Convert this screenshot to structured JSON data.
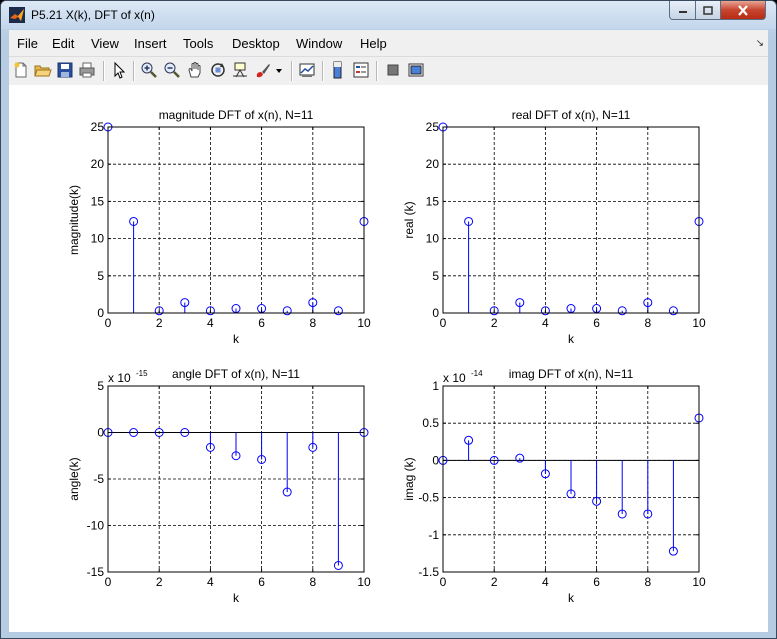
{
  "window": {
    "title": "P5.21 X(k), DFT of x(n)"
  },
  "menu": {
    "items": [
      "File",
      "Edit",
      "View",
      "Insert",
      "Tools",
      "Desktop",
      "Window",
      "Help"
    ]
  },
  "toolbar_icons": [
    "new-figure-icon",
    "open-file-icon",
    "save-icon",
    "print-icon",
    "arrow-select-icon",
    "zoom-in-icon",
    "zoom-out-icon",
    "pan-hand-icon",
    "rotate-3d-icon",
    "data-cursor-icon",
    "brush-icon",
    "dropdown-arrow-icon",
    "link-plot-icon",
    "colorbar-icon",
    "legend-icon",
    "hide-plot-tools-icon",
    "show-plot-tools-icon"
  ],
  "colors": {
    "stem": "#0000ff",
    "axes": "#000000",
    "grid": "#000000"
  },
  "chart_data": [
    {
      "type": "stem",
      "title": "magnitude DFT of x(n), N=11",
      "xlabel": "k",
      "ylabel": "magnitude(k)",
      "xlim": [
        0,
        10
      ],
      "ylim": [
        0,
        25
      ],
      "grid": true,
      "exponent": "",
      "xticks": [
        "0",
        "2",
        "4",
        "6",
        "8",
        "10"
      ],
      "xtick_values": [
        0,
        2,
        4,
        6,
        8,
        10
      ],
      "yticks": [
        "0",
        "5",
        "10",
        "15",
        "20",
        "25"
      ],
      "ytick_values": [
        0,
        5,
        10,
        15,
        20,
        25
      ],
      "x": [
        0,
        1,
        2,
        3,
        4,
        5,
        6,
        7,
        8,
        9,
        10
      ],
      "y": [
        25,
        12.3,
        0.3,
        1.4,
        0.3,
        0.6,
        0.6,
        0.3,
        1.4,
        0.3,
        12.3
      ]
    },
    {
      "type": "stem",
      "title": "real DFT of x(n), N=11",
      "xlabel": "k",
      "ylabel": "real (k)",
      "xlim": [
        0,
        10
      ],
      "ylim": [
        0,
        25
      ],
      "grid": true,
      "exponent": "",
      "xticks": [
        "0",
        "2",
        "4",
        "6",
        "8",
        "10"
      ],
      "xtick_values": [
        0,
        2,
        4,
        6,
        8,
        10
      ],
      "yticks": [
        "0",
        "5",
        "10",
        "15",
        "20",
        "25"
      ],
      "ytick_values": [
        0,
        5,
        10,
        15,
        20,
        25
      ],
      "x": [
        0,
        1,
        2,
        3,
        4,
        5,
        6,
        7,
        8,
        9,
        10
      ],
      "y": [
        25,
        12.3,
        0.3,
        1.4,
        0.3,
        0.6,
        0.6,
        0.3,
        1.4,
        0.3,
        12.3
      ]
    },
    {
      "type": "stem",
      "title": "angle DFT of x(n), N=11",
      "xlabel": "k",
      "ylabel": "angle(k)",
      "xlim": [
        0,
        10
      ],
      "ylim": [
        -15,
        5
      ],
      "grid": true,
      "exponent": "x 10",
      "exponent_power": "-15",
      "xticks": [
        "0",
        "2",
        "4",
        "6",
        "8",
        "10"
      ],
      "xtick_values": [
        0,
        2,
        4,
        6,
        8,
        10
      ],
      "yticks": [
        "-15",
        "-10",
        "-5",
        "0",
        "5"
      ],
      "ytick_values": [
        -15,
        -10,
        -5,
        0,
        5
      ],
      "x": [
        0,
        1,
        2,
        3,
        4,
        5,
        6,
        7,
        8,
        9,
        10
      ],
      "y": [
        0,
        0,
        0,
        0,
        -1.6,
        -2.5,
        -2.9,
        -6.4,
        -1.6,
        -14.3,
        0
      ]
    },
    {
      "type": "stem",
      "title": "imag DFT of x(n), N=11",
      "xlabel": "k",
      "ylabel": "imag (k)",
      "xlim": [
        0,
        10
      ],
      "ylim": [
        -1.5,
        1
      ],
      "grid": true,
      "exponent": "x 10",
      "exponent_power": "-14",
      "xticks": [
        "0",
        "2",
        "4",
        "6",
        "8",
        "10"
      ],
      "xtick_values": [
        0,
        2,
        4,
        6,
        8,
        10
      ],
      "yticks": [
        "-1.5",
        "-1",
        "-0.5",
        "0",
        "0.5",
        "1"
      ],
      "ytick_values": [
        -1.5,
        -1,
        -0.5,
        0,
        0.5,
        1
      ],
      "x": [
        0,
        1,
        2,
        3,
        4,
        5,
        6,
        7,
        8,
        9,
        10
      ],
      "y": [
        0,
        0.27,
        0,
        0.03,
        -0.18,
        -0.45,
        -0.55,
        -0.72,
        -0.72,
        -1.22,
        0.57
      ]
    }
  ]
}
